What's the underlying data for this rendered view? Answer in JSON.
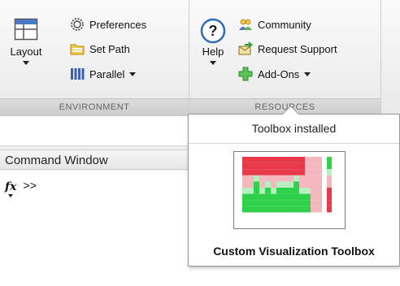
{
  "toolstrip": {
    "environment": {
      "section_label": "ENVIRONMENT",
      "layout_label": "Layout",
      "preferences_label": "Preferences",
      "set_path_label": "Set Path",
      "parallel_label": "Parallel"
    },
    "resources": {
      "section_label": "RESOURCES",
      "help_label": "Help",
      "community_label": "Community",
      "request_support_label": "Request Support",
      "addons_label": "Add-Ons"
    }
  },
  "command_window": {
    "title": "Command Window",
    "fx_label": "fx",
    "prompt": ">>"
  },
  "popup": {
    "message": "Toolbox installed",
    "addon_name": "Custom Visualization Toolbox"
  },
  "colors": {
    "heatmap_red": "#e8394a",
    "heatmap_pink": "#f4b7bd",
    "heatmap_green": "#2fd04a",
    "heatmap_light_green": "#b8efc0"
  }
}
